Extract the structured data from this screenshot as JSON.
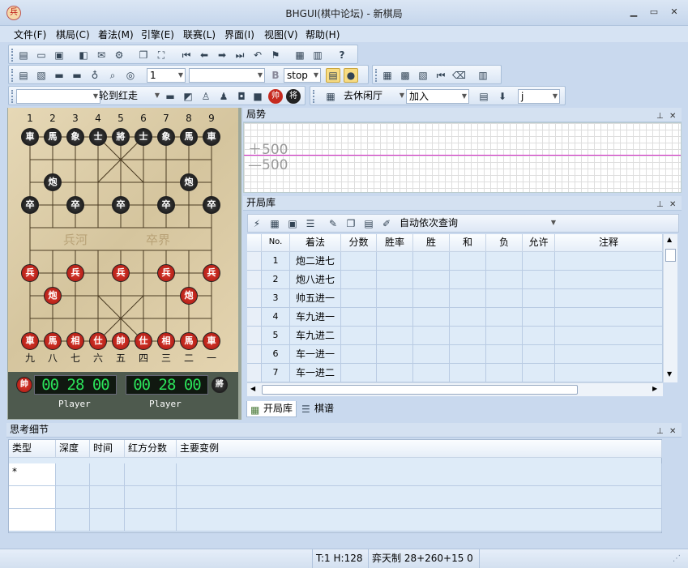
{
  "window": {
    "title": "BHGUI(棋中论坛) - 新棋局",
    "app_icon_glyph": "兵",
    "minimize": "▁",
    "maximize": "▭",
    "close": "✕"
  },
  "menu": [
    "文件(F)",
    "棋局(C)",
    "着法(M)",
    "引擎(E)",
    "联赛(L)",
    "界面(I)",
    "视图(V)",
    "帮助(H)"
  ],
  "toolbar1": {
    "help_glyph": "?"
  },
  "toolbar2": {
    "level_value": "1",
    "b_label": "B",
    "stop_value": "stop"
  },
  "toolbar3": {
    "turn_value": "轮到红走",
    "red_piece": "帅",
    "black_piece": "将",
    "hall_value": "去休闲厅",
    "join_value": "加入",
    "last_value": "j"
  },
  "board": {
    "top_numbers": [
      "1",
      "2",
      "3",
      "4",
      "5",
      "6",
      "7",
      "8",
      "9"
    ],
    "bottom_numbers": [
      "九",
      "八",
      "七",
      "六",
      "五",
      "四",
      "三",
      "二",
      "一"
    ],
    "river_left": "兵河",
    "river_right": "卒界",
    "black_back": [
      "車",
      "馬",
      "象",
      "士",
      "將",
      "士",
      "象",
      "馬",
      "車"
    ],
    "black_cannon": "炮",
    "black_soldier": "卒",
    "red_back": [
      "車",
      "馬",
      "相",
      "仕",
      "帥",
      "仕",
      "相",
      "馬",
      "車"
    ],
    "red_cannon": "炮",
    "red_soldier": "兵"
  },
  "clocks": {
    "red_badge": "帥",
    "black_badge": "將",
    "red_time": "00 28 00",
    "black_time": "00 28 00",
    "red_player": "Player",
    "black_player": "Player"
  },
  "situation_panel": {
    "title": "局势",
    "plus_label": "＋500",
    "minus_label": "—500"
  },
  "book_panel": {
    "title": "开局库",
    "query_value": "自动依次查询",
    "headers": [
      "No.",
      "着法",
      "分数",
      "胜率",
      "胜",
      "和",
      "负",
      "允许",
      "注释"
    ],
    "rows": [
      {
        "no": "1",
        "move": "炮二进七"
      },
      {
        "no": "2",
        "move": "炮八进七"
      },
      {
        "no": "3",
        "move": "帅五进一"
      },
      {
        "no": "4",
        "move": "车九进一"
      },
      {
        "no": "5",
        "move": "车九进二"
      },
      {
        "no": "6",
        "move": "车一进一"
      },
      {
        "no": "7",
        "move": "车一进二"
      }
    ],
    "tabs": [
      "开局库",
      "棋谱"
    ]
  },
  "think_panel": {
    "title": "思考细节",
    "headers": [
      "类型",
      "深度",
      "时间",
      "红方分数",
      "主要变例"
    ],
    "first_row_marker": "*"
  },
  "status": {
    "pos": "T:1 H:128",
    "rule": "弈天制 28+260+15 0"
  },
  "colors": {
    "accent_line": "#d428c8",
    "clock_green": "#2be25a",
    "red_piece": "#c62a1f",
    "black_piece": "#222222"
  }
}
